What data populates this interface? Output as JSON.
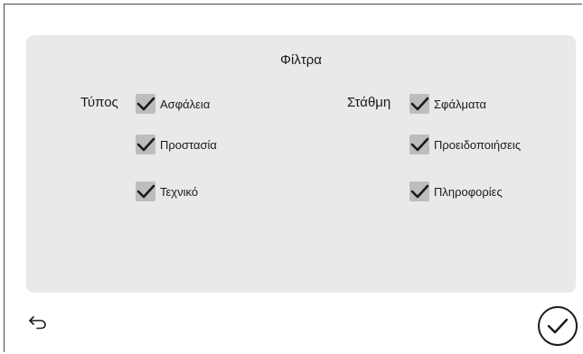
{
  "filters": {
    "title": "Φίλτρα",
    "type_label": "Τύπος",
    "level_label": "Στάθμη",
    "type_options": [
      {
        "label": "Ασφάλεια",
        "checked": true
      },
      {
        "label": "Προστασία",
        "checked": true
      },
      {
        "label": "Τεχνικό",
        "checked": true
      }
    ],
    "level_options": [
      {
        "label": "Σφάλματα",
        "checked": true
      },
      {
        "label": "Προειδοποιήσεις",
        "checked": true
      },
      {
        "label": "Πληροφορίες",
        "checked": true
      }
    ]
  },
  "footer": {
    "back_icon": "undo-arrow-icon",
    "confirm_icon": "check-circle-icon"
  },
  "colors": {
    "panel_bg": "#e9e9e9",
    "checkbox_bg": "#bdbdbd",
    "checkmark": "#1a1a1a"
  }
}
